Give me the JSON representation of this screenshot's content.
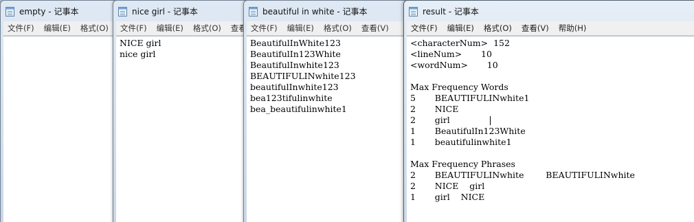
{
  "windows": [
    {
      "title": "empty - 记事本",
      "menu": [
        "文件(F)",
        "编辑(E)",
        "格式(O)"
      ],
      "lines": []
    },
    {
      "title": "nice girl - 记事本",
      "menu": [
        "文件(F)",
        "编辑(E)",
        "格式(O)",
        "查看"
      ],
      "lines": [
        "NICE girl",
        "nice girl"
      ]
    },
    {
      "title": "beautiful in white - 记事本",
      "menu": [
        "文件(F)",
        "编辑(E)",
        "格式(O)",
        "查看(V)"
      ],
      "lines": [
        "BeautifulInWhite123",
        "BeautifulIn123White",
        "BeautifulInwhite123",
        "BEAUTIFULINwhite123",
        "beautifulInwhite123",
        "bea123tifulinwhite",
        "bea_beautifulinwhite1"
      ]
    },
    {
      "title": "result - 记事本",
      "menu": [
        "文件(F)",
        "编辑(E)",
        "格式(O)",
        "查看(V)",
        "帮助(H)"
      ],
      "lines": [
        "<characterNum>  152",
        "<lineNum>       10",
        "<wordNum>       10",
        "",
        "Max Frequency Words",
        "5       BEAUTIFULINwhite1",
        "2       NICE",
        "2       girl",
        "1       BeautifulIn123White",
        "1       beautifulinwhite1",
        "",
        "Max Frequency Phrases",
        "2       BEAUTIFULINwhite        BEAUTIFULINwhite",
        "2       NICE    girl",
        "1       girl    NICE"
      ]
    }
  ]
}
